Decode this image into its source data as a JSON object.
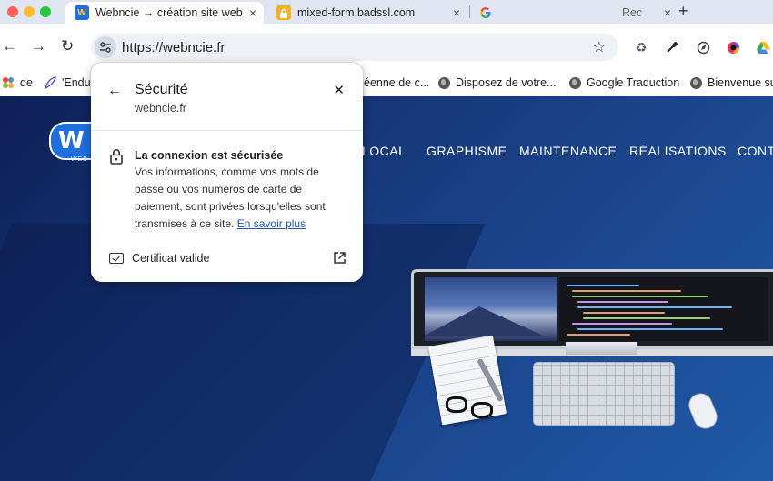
{
  "tabs": [
    {
      "title": "Webncie → création site web",
      "close": "×"
    },
    {
      "title": "mixed-form.badssl.com",
      "close": "×"
    },
    {
      "title": "",
      "close": ""
    },
    {
      "title": "Rec",
      "close": "×"
    }
  ],
  "newtab_label": "+",
  "toolbar": {
    "back": "←",
    "forward": "→",
    "reload": "↻",
    "url": "https://webncie.fr",
    "star": "☆"
  },
  "bookmarks": [
    {
      "label": "de"
    },
    {
      "label": "'Endu"
    },
    {
      "label": "éenne de c..."
    },
    {
      "label": "Disposez de votre..."
    },
    {
      "label": "Google Traduction"
    },
    {
      "label": "Bienvenue sur"
    }
  ],
  "site": {
    "logo_letter": "W",
    "logo_sub": "WEB",
    "menu": [
      "LOCAL",
      "GRAPHISME",
      "MAINTENANCE",
      "RÉALISATIONS",
      "CONTA"
    ]
  },
  "popup": {
    "back": "←",
    "title": "Sécurité",
    "domain": "webncie.fr",
    "close": "✕",
    "heading": "La connexion est sécurisée",
    "body": "Vos informations, comme vos mots de passe ou vos numéros de carte de paiement, sont privées lorsqu'elles sont transmises à ce site.",
    "link": "En savoir plus",
    "cert_label": "Certificat valide"
  },
  "colors": {
    "page_bg": "#16377a",
    "tab_strip": "#dfe6f1",
    "link": "#1a56c4"
  }
}
